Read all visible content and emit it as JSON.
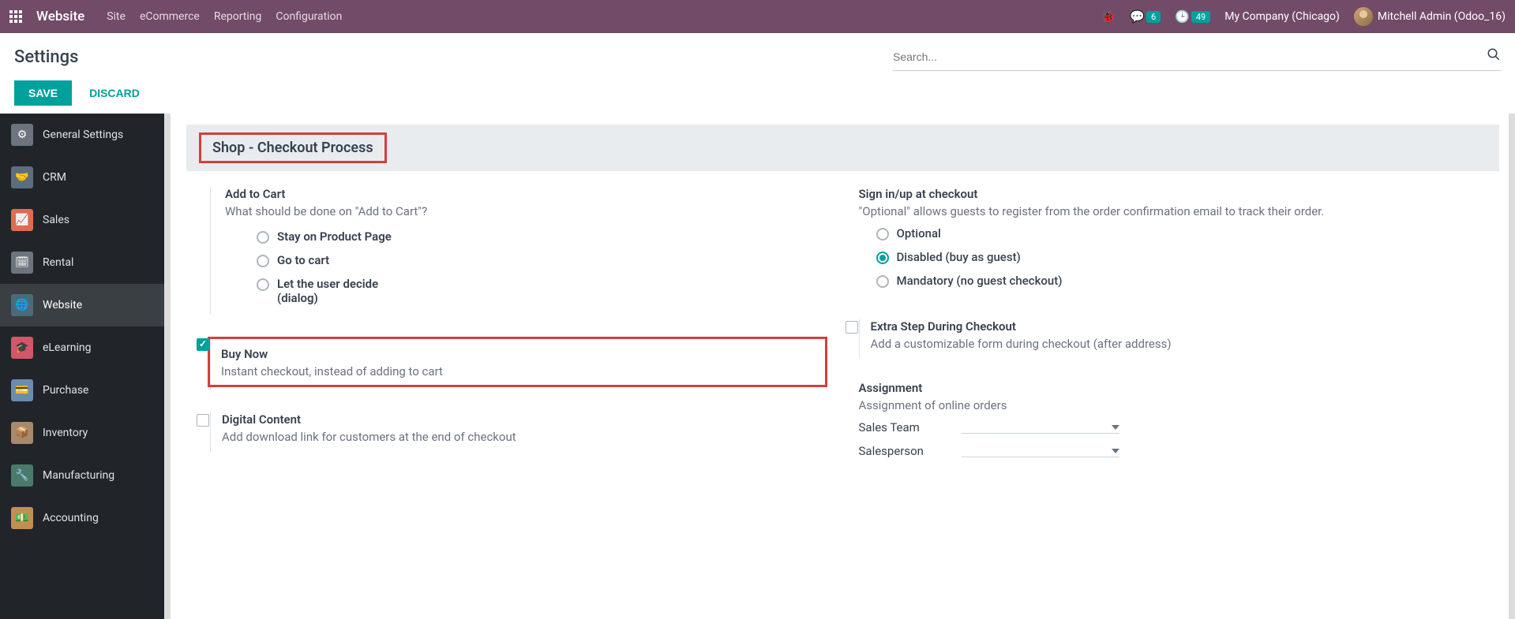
{
  "navbar": {
    "brand": "Website",
    "menu": [
      "Site",
      "eCommerce",
      "Reporting",
      "Configuration"
    ],
    "messages_count": "6",
    "activities_count": "49",
    "company": "My Company (Chicago)",
    "user": "Mitchell Admin (Odoo_16)"
  },
  "header": {
    "title": "Settings",
    "search_placeholder": "Search...",
    "save": "SAVE",
    "discard": "DISCARD"
  },
  "sidebar": [
    {
      "label": "General Settings",
      "icon": "⚙",
      "color": "#6c757d"
    },
    {
      "label": "CRM",
      "icon": "🤝",
      "color": "#5b6e80"
    },
    {
      "label": "Sales",
      "icon": "📈",
      "color": "#e06c50"
    },
    {
      "label": "Rental",
      "icon": "🗓",
      "color": "#6c757d"
    },
    {
      "label": "Website",
      "icon": "🌐",
      "color": "#4a6a7a",
      "active": true
    },
    {
      "label": "eLearning",
      "icon": "🎓",
      "color": "#d4566b"
    },
    {
      "label": "Purchase",
      "icon": "💳",
      "color": "#6a8caf"
    },
    {
      "label": "Inventory",
      "icon": "📦",
      "color": "#a8896c"
    },
    {
      "label": "Manufacturing",
      "icon": "🔧",
      "color": "#4a7a6a"
    },
    {
      "label": "Accounting",
      "icon": "💵",
      "color": "#c09050"
    }
  ],
  "section": {
    "title": "Shop - Checkout Process"
  },
  "settings": {
    "add_to_cart": {
      "title": "Add to Cart",
      "desc": "What should be done on \"Add to Cart\"?",
      "options": [
        "Stay on Product Page",
        "Go to cart",
        "Let the user decide (dialog)"
      ]
    },
    "sign_in": {
      "title": "Sign in/up at checkout",
      "desc": "\"Optional\" allows guests to register from the order confirmation email to track their order.",
      "options": [
        "Optional",
        "Disabled (buy as guest)",
        "Mandatory (no guest checkout)"
      ],
      "selected": 1
    },
    "buy_now": {
      "title": "Buy Now",
      "desc": "Instant checkout, instead of adding to cart",
      "checked": true
    },
    "extra_step": {
      "title": "Extra Step During Checkout",
      "desc": "Add a customizable form during checkout (after address)"
    },
    "digital": {
      "title": "Digital Content",
      "desc": "Add download link for customers at the end of checkout"
    },
    "assignment": {
      "title": "Assignment",
      "desc": "Assignment of online orders",
      "fields": {
        "sales_team": "Sales Team",
        "salesperson": "Salesperson"
      }
    }
  }
}
